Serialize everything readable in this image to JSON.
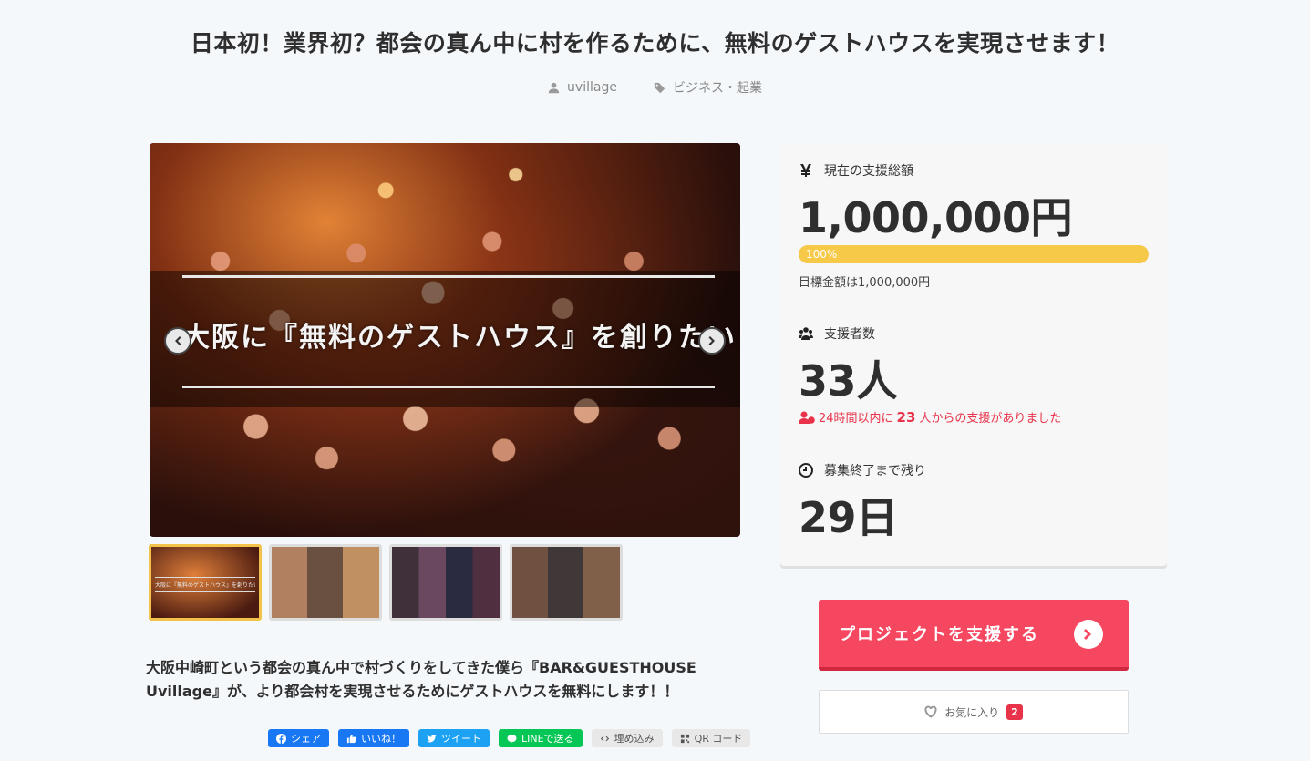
{
  "project": {
    "title": "日本初！業界初？都会の真ん中に村を作るために、無料のゲストハウスを実現させます！",
    "owner": "uvillage",
    "category": "ビジネス・起業"
  },
  "gallery": {
    "overlay_text": "大阪に『無料のゲストハウス』を創りたい！",
    "thumb_text": "大阪に『無料のゲストハウス』を創りたい！",
    "thumbnail_count": 4,
    "active_index": 0
  },
  "description": "大阪中崎町という都会の真ん中で村づくりをしてきた僕ら『BAR&GUESTHOUSE Uvillage』が、より都会村を実現させるためにゲストハウスを無料にします！！",
  "share": {
    "facebook": "シェア",
    "like": "いいね！",
    "twitter": "ツイート",
    "line": "LINEで送る",
    "embed": "埋め込み",
    "qr": "QR コード"
  },
  "stats": {
    "total_label": "現在の支援総額",
    "total_value": "1,000,000円",
    "progress_percent": 100,
    "progress_text": "100%",
    "goal_text": "目標金額は1,000,000円",
    "supporters_label": "支援者数",
    "supporters_value": "33人",
    "recent_prefix": "24時間以内に",
    "recent_count": "23",
    "recent_suffix": "人からの支援がありました",
    "remaining_label": "募集終了まで残り",
    "remaining_value": "29日"
  },
  "actions": {
    "support_label": "プロジェクトを支援する",
    "favorite_label": "お気に入り",
    "favorite_count": "2"
  },
  "colors": {
    "accent": "#f5475f",
    "progress": "#f7c948",
    "alert": "#e8334a",
    "facebook": "#1877f2",
    "twitter": "#1da1f2",
    "line": "#06c755"
  }
}
